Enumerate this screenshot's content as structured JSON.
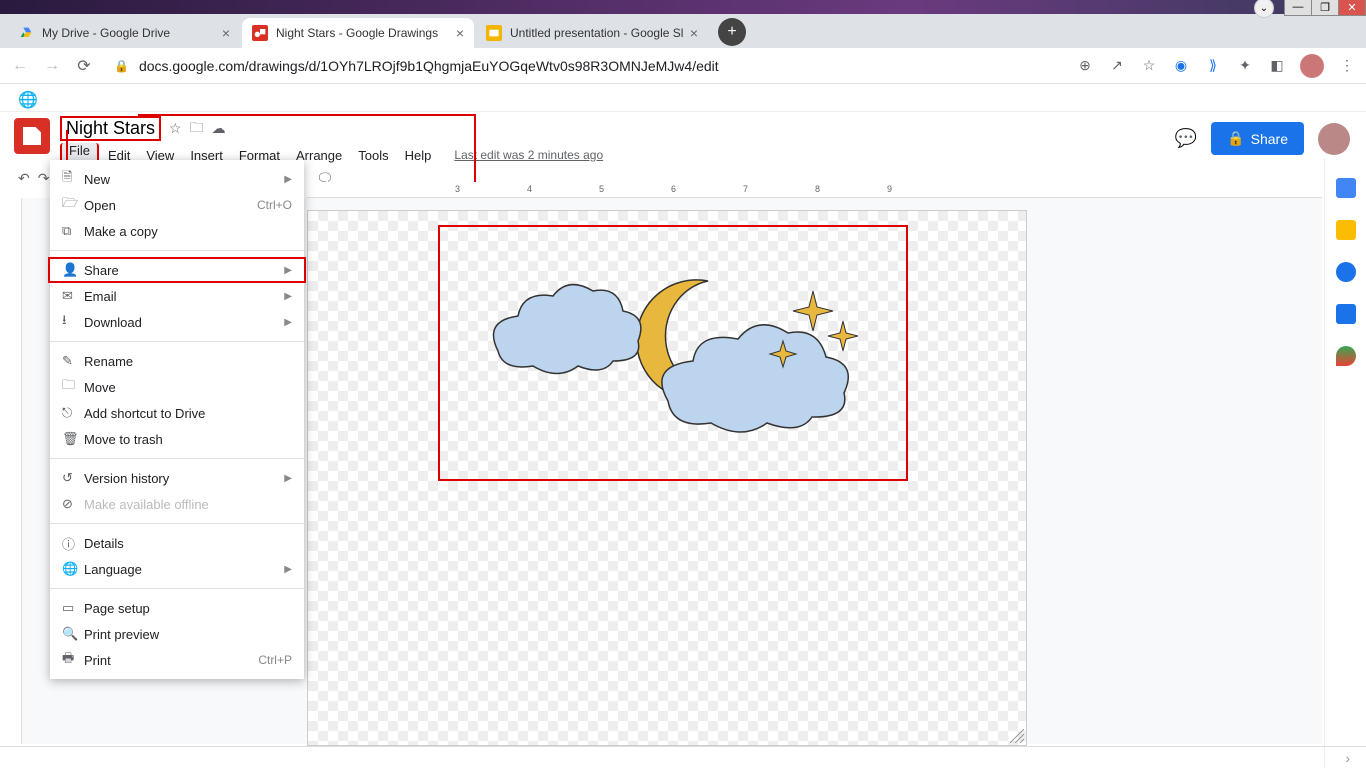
{
  "window": {
    "min": "—",
    "max": "❐",
    "close": "✕",
    "dot": "⌄"
  },
  "tabs": [
    {
      "title": "My Drive - Google Drive"
    },
    {
      "title": "Night Stars - Google Drawings"
    },
    {
      "title": "Untitled presentation - Google Sl"
    }
  ],
  "url": "docs.google.com/drawings/d/1OYh7LROjf9b1QhgmjaEuYOGqeWtv0s98R3OMNJeMJw4/edit",
  "doc": {
    "title": "Night Stars",
    "menus": [
      "File",
      "Edit",
      "View",
      "Insert",
      "Format",
      "Arrange",
      "Tools",
      "Help"
    ],
    "last_edit": "Last edit was 2 minutes ago",
    "share": "Share"
  },
  "file_menu": {
    "new": "New",
    "open": "Open",
    "open_sc": "Ctrl+O",
    "copy": "Make a copy",
    "share": "Share",
    "email": "Email",
    "download": "Download",
    "rename": "Rename",
    "move": "Move",
    "shortcut": "Add shortcut to Drive",
    "trash": "Move to trash",
    "history": "Version history",
    "offline": "Make available offline",
    "details": "Details",
    "language": "Language",
    "pagesetup": "Page setup",
    "preview": "Print preview",
    "print": "Print",
    "print_sc": "Ctrl+P"
  },
  "ruler_ticks": [
    "3",
    "4",
    "5",
    "6",
    "7",
    "8",
    "9"
  ]
}
